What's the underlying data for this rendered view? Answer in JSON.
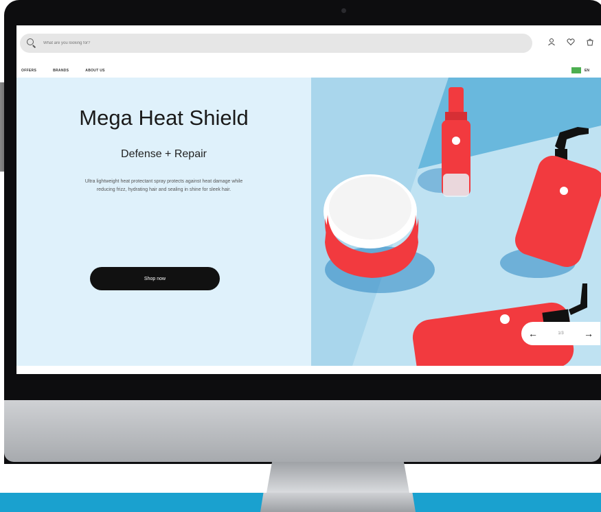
{
  "header": {
    "search_placeholder": "What are you looking for?",
    "icons": [
      "user-icon",
      "heart-icon",
      "cart-icon"
    ],
    "nav": [
      "OFFERS",
      "BRANDS",
      "ABOUT US"
    ],
    "language": "EN"
  },
  "hero": {
    "title": "Mega Heat Shield",
    "subtitle": "Defense + Repair",
    "description_line1": "Ultra lightweight heat protectant spray protects against heat damage while",
    "description_line2": "reducing frizz, hydrating hair and sealing in shine for sleek hair.",
    "button_label": "Shop now",
    "slider_counter": "1/3"
  },
  "colors": {
    "accent": "#1aa1cf",
    "hero_bg": "#dff1fb",
    "product_red": "#f23a3f",
    "button": "#111111"
  }
}
